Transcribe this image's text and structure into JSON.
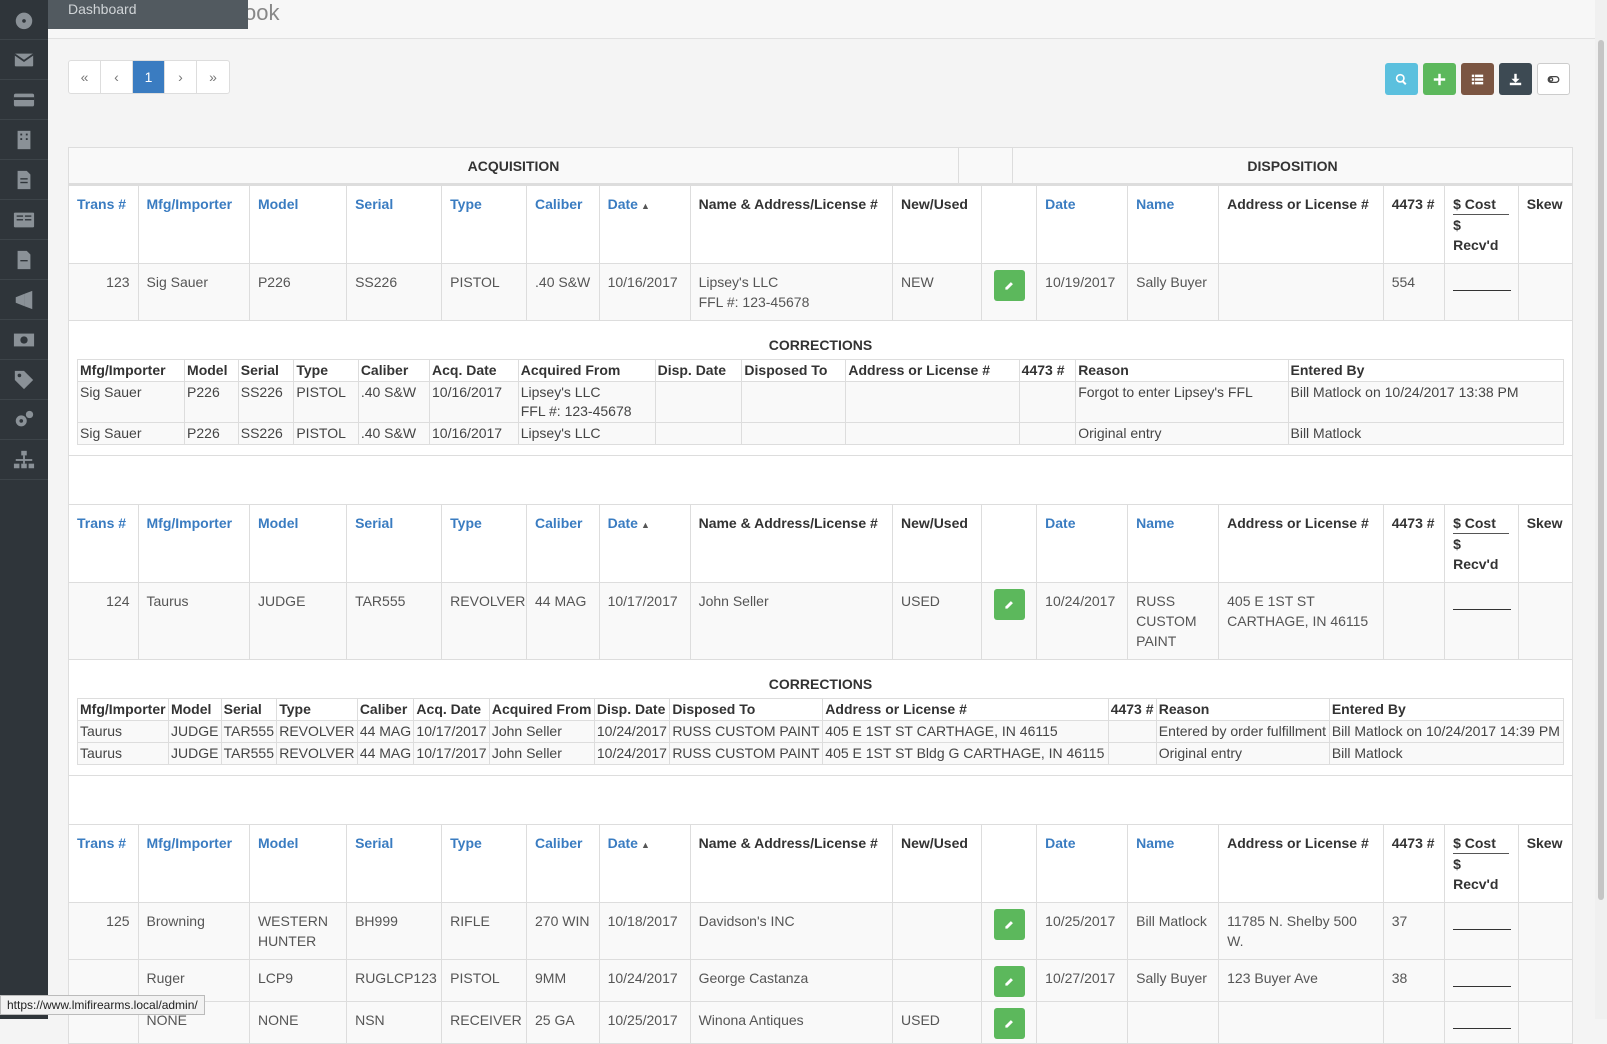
{
  "sidebar": {
    "tooltip": "Dashboard",
    "icons": [
      "dashboard-icon",
      "envelope-icon",
      "credit-card-icon",
      "building-icon",
      "document-icon",
      "newspaper-icon",
      "file-icon",
      "megaphone-icon",
      "money-icon",
      "tags-icon",
      "cogs-icon",
      "sitemap-icon"
    ]
  },
  "header": {
    "title_fragment": "ook"
  },
  "pager": {
    "first": "«",
    "prev": "‹",
    "current": "1",
    "next": "›",
    "last": "»"
  },
  "toolbar": {
    "buttons": [
      "search-icon",
      "plus-icon",
      "list-icon",
      "download-icon",
      "toggle-icon"
    ]
  },
  "groups": {
    "acquisition": "ACQUISITION",
    "disposition": "DISPOSITION"
  },
  "columns": {
    "trans": "Trans #",
    "mfg": "Mfg/Importer",
    "model": "Model",
    "serial": "Serial",
    "type": "Type",
    "caliber": "Caliber",
    "date": "Date",
    "name_addr": "Name & Address/License #",
    "new_used": "New/Used",
    "d_date": "Date",
    "d_name": "Name",
    "d_addr": "Address or License #",
    "f4473": "4473 #",
    "cost": "$ Cost",
    "recvd": "$ Recv'd",
    "skew": "Skew"
  },
  "corrections_title": "CORRECTIONS",
  "corr_columns": {
    "mfg": "Mfg/Importer",
    "model": "Model",
    "serial": "Serial",
    "type": "Type",
    "caliber": "Caliber",
    "acq_date": "Acq. Date",
    "acq_from": "Acquired From",
    "disp_date": "Disp. Date",
    "disp_to": "Disposed To",
    "addr": "Address or License #",
    "f4473": "4473 #",
    "reason": "Reason",
    "entered_by": "Entered By"
  },
  "records": [
    {
      "trans": "123",
      "mfg": "Sig Sauer",
      "model": "P226",
      "serial": "SS226",
      "type": "PISTOL",
      "caliber": ".40 S&W",
      "date": "10/16/2017",
      "name_line1": "Lipsey's LLC",
      "name_line2": "FFL #: 123-45678",
      "new_used": "NEW",
      "d_date": "10/19/2017",
      "d_name": "Sally Buyer",
      "d_addr": "",
      "f4473": "554",
      "corrections": [
        {
          "mfg": "Sig Sauer",
          "model": "P226",
          "serial": "SS226",
          "type": "PISTOL",
          "caliber": ".40 S&W",
          "acq_date": "10/16/2017",
          "acq_from_1": "Lipsey's LLC",
          "acq_from_2": "FFL #: 123-45678",
          "disp_date": "",
          "disp_to": "",
          "addr": "",
          "f4473": "",
          "reason": "Forgot to enter Lipsey's FFL",
          "entered_by": "Bill Matlock on 10/24/2017 13:38 PM"
        },
        {
          "mfg": "Sig Sauer",
          "model": "P226",
          "serial": "SS226",
          "type": "PISTOL",
          "caliber": ".40 S&W",
          "acq_date": "10/16/2017",
          "acq_from_1": "Lipsey's LLC",
          "acq_from_2": "",
          "disp_date": "",
          "disp_to": "",
          "addr": "",
          "f4473": "",
          "reason": "Original entry",
          "entered_by": "Bill Matlock"
        }
      ]
    },
    {
      "trans": "124",
      "mfg": "Taurus",
      "model": "JUDGE",
      "serial": "TAR555",
      "type": "REVOLVER",
      "caliber": "44 MAG",
      "date": "10/17/2017",
      "name_line1": "John Seller",
      "name_line2": "",
      "new_used": "USED",
      "d_date": "10/24/2017",
      "d_name": "RUSS CUSTOM PAINT",
      "d_addr": "405 E 1ST ST CARTHAGE, IN 46115",
      "f4473": "",
      "corrections": [
        {
          "mfg": "Taurus",
          "model": "JUDGE",
          "serial": "TAR555",
          "type": "REVOLVER",
          "caliber": "44 MAG",
          "acq_date": "10/17/2017",
          "acq_from_1": "John Seller",
          "acq_from_2": "",
          "disp_date": "10/24/2017",
          "disp_to": "RUSS CUSTOM PAINT",
          "addr": "405 E 1ST ST CARTHAGE, IN 46115",
          "f4473": "",
          "reason": "Entered by order fulfillment",
          "entered_by": "Bill Matlock on 10/24/2017 14:39 PM"
        },
        {
          "mfg": "Taurus",
          "model": "JUDGE",
          "serial": "TAR555",
          "type": "REVOLVER",
          "caliber": "44 MAG",
          "acq_date": "10/17/2017",
          "acq_from_1": "John Seller",
          "acq_from_2": "",
          "disp_date": "10/24/2017",
          "disp_to": "RUSS CUSTOM PAINT",
          "addr": "405 E 1ST ST Bldg G CARTHAGE, IN 46115",
          "f4473": "",
          "reason": "Original entry",
          "entered_by": "Bill Matlock"
        }
      ]
    },
    {
      "group": [
        {
          "trans": "125",
          "mfg": "Browning",
          "model": "WESTERN HUNTER",
          "serial": "BH999",
          "type": "RIFLE",
          "caliber": "270 WIN",
          "date": "10/18/2017",
          "name_line1": "Davidson's INC",
          "name_line2": "",
          "new_used": "",
          "d_date": "10/25/2017",
          "d_name": "Bill Matlock",
          "d_addr": "11785 N. Shelby 500 W.",
          "f4473": "37"
        },
        {
          "trans": "",
          "mfg": "Ruger",
          "model": "LCP9",
          "serial": "RUGLCP123",
          "type": "PISTOL",
          "caliber": "9MM",
          "date": "10/24/2017",
          "name_line1": "George Castanza",
          "name_line2": "",
          "new_used": "",
          "d_date": "10/27/2017",
          "d_name": "Sally Buyer",
          "d_addr": "123 Buyer Ave",
          "f4473": "38"
        },
        {
          "trans": "",
          "mfg": "NONE",
          "model": "NONE",
          "serial": "NSN",
          "type": "RECEIVER",
          "caliber": "25 GA",
          "date": "10/25/2017",
          "name_line1": "Winona Antiques",
          "name_line2": "",
          "new_used": "USED",
          "d_date": "",
          "d_name": "",
          "d_addr": "",
          "f4473": ""
        }
      ]
    }
  ],
  "status_url": "https://www.lmifirearms.local/admin/",
  "colors": {
    "sidebar": "#2f353a",
    "link": "#3a7cc1",
    "edit": "#5cb85c",
    "search": "#5bc0de"
  }
}
